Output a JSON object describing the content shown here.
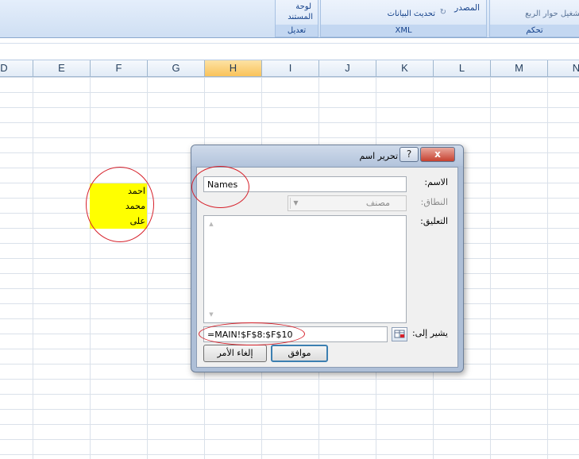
{
  "ribbon": {
    "groups": [
      {
        "label": "تعديل",
        "item1": "لوحة",
        "item2": "المستند"
      },
      {
        "label": "XML",
        "source": "المصدر",
        "refresh": "تحديث البيانات"
      },
      {
        "label": "تحكم",
        "dialog": "تشغيل حوار الربع"
      }
    ]
  },
  "columns": [
    "D",
    "E",
    "F",
    "G",
    "H",
    "I",
    "J",
    "K",
    "L",
    "M",
    "N"
  ],
  "active_column": "H",
  "cells": [
    "احمد",
    "محمد",
    "على"
  ],
  "colors": {
    "highlight": "#ffff00",
    "annotation": "#d6202a",
    "active_header": "#f9c35a"
  },
  "dialog": {
    "title": "تحرير اسم",
    "help": "?",
    "close": "x",
    "name_label": "الاسم:",
    "name_value": "Names",
    "scope_label": "النطاق:",
    "scope_value": "مصنف",
    "comment_label": "التعليق:",
    "refers_label": "يشير إلى:",
    "refers_value": "=MAIN!$F$8:$F$10",
    "ok": "موافق",
    "cancel": "إلغاء الأمر"
  }
}
